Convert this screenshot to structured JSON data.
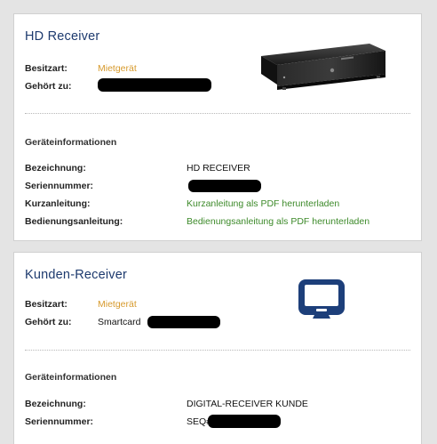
{
  "hd_receiver": {
    "title": "HD Receiver",
    "ownership_label": "Besitzart:",
    "ownership_value": "Mietgerät",
    "belongs_label": "Gehört zu:",
    "device_info_title": "Geräteinformationen",
    "designation_label": "Bezeichnung:",
    "designation_value": "HD RECEIVER",
    "serial_label": "Seriennummer:",
    "quick_guide_label": "Kurzanleitung:",
    "quick_guide_link": "Kurzanleitung als PDF herunterladen",
    "manual_label": "Bedienungsanleitung:",
    "manual_link": "Bedienungsanleitung als PDF herunterladen"
  },
  "customer_receiver": {
    "title": "Kunden-Receiver",
    "ownership_label": "Besitzart:",
    "ownership_value": "Mietgerät",
    "belongs_label": "Gehört zu:",
    "belongs_value": "Smartcard",
    "device_info_title": "Geräteinformationen",
    "designation_label": "Bezeichnung:",
    "designation_value": "DIGITAL-RECEIVER KUNDE",
    "serial_label": "Seriennummer:",
    "serial_prefix": "SEQ#"
  },
  "icons": {
    "hd_receiver_image": "set-top-box-icon",
    "customer_receiver_image": "tv-screen-icon"
  },
  "colors": {
    "title": "#1d3a6e",
    "ownership": "#d79a2d",
    "link": "#3d8a2a",
    "tv_icon": "#1d3f7a"
  }
}
